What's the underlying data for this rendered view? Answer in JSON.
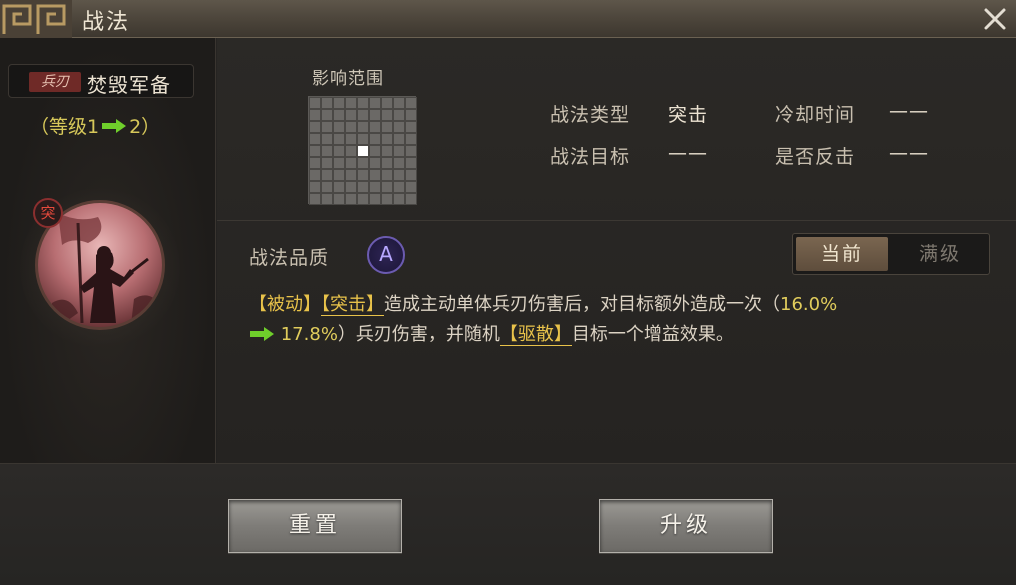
{
  "window": {
    "title": "战法"
  },
  "skill": {
    "type_tag": "兵刃",
    "name": "焚毁军备",
    "level_open": "（等级1",
    "level_close": "2）",
    "portrait_badge": "突"
  },
  "range": {
    "label": "影响范围",
    "rows": 9,
    "cols": 9,
    "active_cell": [
      4,
      4
    ]
  },
  "info": {
    "type_label": "战法类型",
    "type_value": "突击",
    "target_label": "战法目标",
    "target_value": "——",
    "cooldown_label": "冷却时间",
    "cooldown_value": "——",
    "counter_label": "是否反击",
    "counter_value": "——"
  },
  "quality": {
    "label": "战法品质",
    "grade": "A"
  },
  "toggle": {
    "current": "当前",
    "max": "满级"
  },
  "description": {
    "tag1": "【被动】",
    "tag2": "【突击】",
    "text1": "造成主动单体兵刃伤害后，对目标额外造成一次（",
    "pct_from": "16.0%",
    "pct_to": "17.8%",
    "text2": "）兵刃伤害，并随机",
    "tag3": "【驱散】",
    "text3": "目标一个增益效果。"
  },
  "buttons": {
    "reset": "重置",
    "upgrade": "升级"
  },
  "colors": {
    "accent_gold": "#e8c24a",
    "arrow_green": "#6fcf2b",
    "quality_purple": "#6b5bb0"
  }
}
